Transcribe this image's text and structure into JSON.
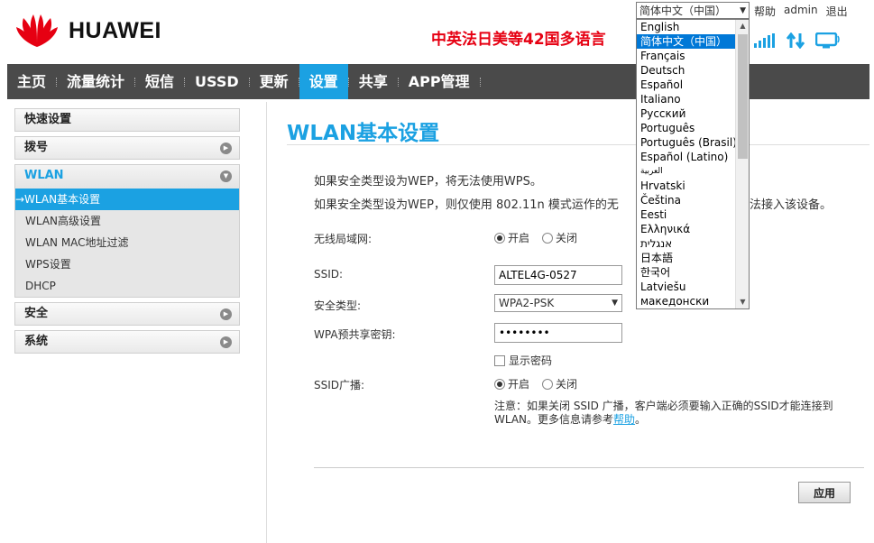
{
  "header": {
    "brand": "HUAWEI",
    "promo": "中英法日美等42国多语言",
    "links": {
      "help": "帮助",
      "user": "admin",
      "logout": "退出"
    }
  },
  "language": {
    "selected": "简体中文（中国）",
    "options": [
      "English",
      "简体中文（中国）",
      "Français",
      "Deutsch",
      "Español",
      "Italiano",
      "Русский",
      "Português",
      "Português (Brasil)",
      "Español (Latino)",
      "العربية",
      "Hrvatski",
      "Čeština",
      "Eesti",
      "Ελληνικά",
      "אנגלית",
      "日本語",
      "한국어",
      "Latviešu",
      "македонски"
    ]
  },
  "nav": {
    "items": [
      "主页",
      "流量统计",
      "短信",
      "USSD",
      "更新",
      "设置",
      "共享",
      "APP管理"
    ],
    "active": "设置"
  },
  "sidebar": {
    "quick": "快速设置",
    "dial": "拨号",
    "wlan": "WLAN",
    "wlan_items": [
      "→WLAN基本设置",
      "WLAN高级设置",
      "WLAN MAC地址过滤",
      "WPS设置",
      "DHCP"
    ],
    "security": "安全",
    "system": "系统"
  },
  "content": {
    "title": "WLAN基本设置",
    "note1": "如果安全类型设为WEP，将无法使用WPS。",
    "note2": "如果安全类型设为WEP，则仅使用 802.11n 模式运作的无",
    "note2_tail": "法接入该设备。",
    "wlan_label": "无线局域网:",
    "on": "开启",
    "off": "关闭",
    "ssid_label": "SSID:",
    "ssid_value": "ALTEL4G-0527",
    "security_label": "安全类型:",
    "security_value": "WPA2-PSK",
    "psk_label": "WPA预共享密钥:",
    "psk_value": "••••••••",
    "show_password": "显示密码",
    "broadcast_label": "SSID广播:",
    "hint_text": "注意：如果关闭 SSID 广播，客户端必须要输入正确的SSID才能连接到 WLAN。更多信息请参考",
    "hint_link": "帮助",
    "hint_end": "。",
    "apply": "应用"
  },
  "colors": {
    "accent": "#1ba1e2",
    "nav_bg": "#4a4a4a",
    "promo": "#e60012",
    "logo": "#e60012"
  }
}
